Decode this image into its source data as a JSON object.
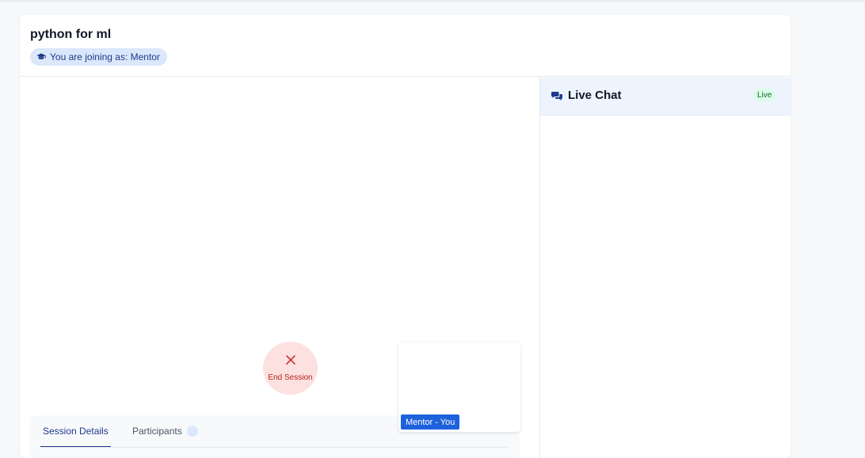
{
  "session": {
    "title": "python for ml",
    "role_badge": "You are joining as: Mentor",
    "role_icon": "graduation-cap-icon"
  },
  "controls": {
    "end_session_label": "End Session",
    "end_icon": "close-icon"
  },
  "self_view": {
    "label": "Mentor - You"
  },
  "tabs": [
    {
      "label": "Session Details",
      "active": true
    },
    {
      "label": "Participants",
      "active": false
    }
  ],
  "chat": {
    "title": "Live Chat",
    "status_badge": "Live",
    "icon": "chat-bubbles-icon"
  },
  "colors": {
    "accent": "#1d62dc",
    "danger": "#b42318",
    "live": "#166534"
  }
}
